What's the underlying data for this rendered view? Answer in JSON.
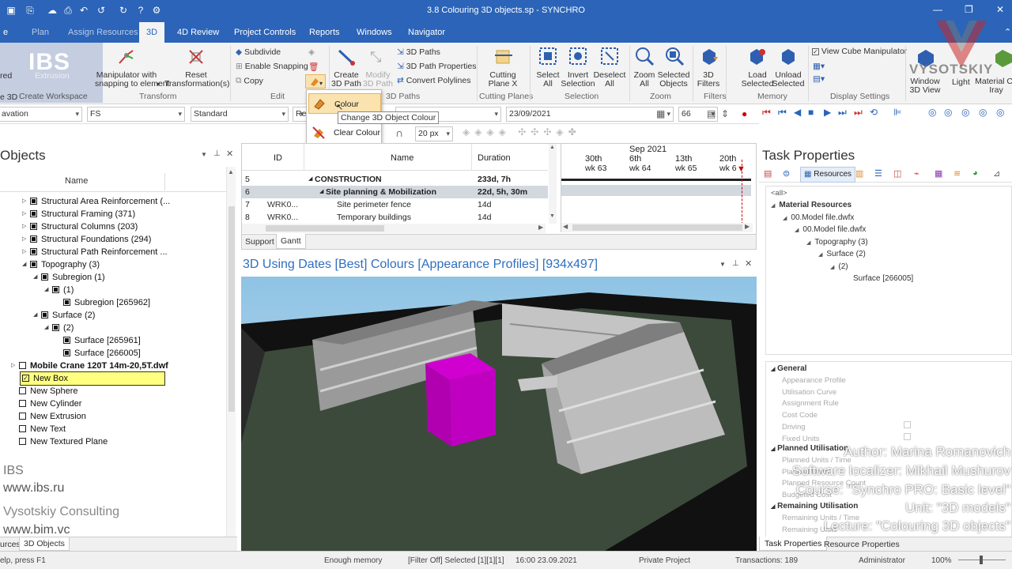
{
  "window": {
    "title": "3.8 Colouring 3D objects.sp - SYNCHRO"
  },
  "ribbon_tabs": [
    "Plan",
    "Assign Resources",
    "3D",
    "4D Review",
    "Project Controls",
    "Reports",
    "Windows",
    "Navigator"
  ],
  "ribbon": {
    "logo_text": "IBS",
    "left_partial": [
      "red",
      "e 3D"
    ],
    "create_workspace": "Create Workspace",
    "extrusion": "Extrusion",
    "manipulator": [
      "Manipulator with",
      "snapping to element"
    ],
    "reset": [
      "Reset",
      "Transformation(s)"
    ],
    "transform_group": "Transform",
    "subdivide": "Subdivide",
    "enable_snapping": "Enable Snapping",
    "copy": "Copy",
    "edit_group": "Edit",
    "create_path": [
      "Create",
      "3D Path"
    ],
    "modify_path": [
      "Modify",
      "3D Path"
    ],
    "paths": "3D Paths",
    "path_props": "3D Path Properties",
    "convert_poly": "Convert Polylines",
    "paths_group": "3D Paths",
    "cutting_plane": [
      "Cutting",
      "Plane X"
    ],
    "cutting_group": "Cutting Planes",
    "select_all": [
      "Select",
      "All"
    ],
    "invert_sel": [
      "Invert",
      "Selection"
    ],
    "deselect_all": [
      "Deselect",
      "All"
    ],
    "selection_group": "Selection",
    "zoom_all": [
      "Zoom",
      "All"
    ],
    "sel_objects": [
      "Selected",
      "Objects"
    ],
    "zoom_group": "Zoom",
    "filters_btn": [
      "3D",
      "Filters"
    ],
    "filters_group": "Filters",
    "load_sel": [
      "Load",
      "Selected"
    ],
    "unload_sel": [
      "Unload",
      "Selected"
    ],
    "memory_group": "Memory",
    "view_cube": "View Cube Manipulator",
    "display_group": "Display Settings",
    "window_lbl": [
      "Window",
      "3D View"
    ],
    "light": "Light",
    "material": [
      "Material Co",
      "Iray"
    ]
  },
  "dropdown": {
    "colour": "Colour",
    "clear": "Clear Colour",
    "tooltip": "Change 3D Object Colour"
  },
  "toolbar": {
    "elevation": "avation",
    "fs": "FS",
    "standard": "Standard",
    "res": "Res",
    "date": "23/09/2021",
    "num": "66",
    "px": "20 px"
  },
  "objects": {
    "title": "Objects",
    "name_col": "Name",
    "rows": [
      {
        "text": "Structural Area Reinforcement (...",
        "indent": 0,
        "exp": "▷",
        "cb": "f",
        "bold": false
      },
      {
        "text": "Structural Framing (371)",
        "indent": 0,
        "exp": "▷",
        "cb": "f",
        "bold": false
      },
      {
        "text": "Structural Columns (203)",
        "indent": 0,
        "exp": "▷",
        "cb": "f",
        "bold": false
      },
      {
        "text": "Structural Foundations (294)",
        "indent": 0,
        "exp": "▷",
        "cb": "f",
        "bold": false
      },
      {
        "text": "Structural Path Reinforcement ...",
        "indent": 0,
        "exp": "▷",
        "cb": "f",
        "bold": false
      },
      {
        "text": "Topography (3)",
        "indent": 0,
        "exp": "◢",
        "cb": "f",
        "bold": false
      },
      {
        "text": "Subregion (1)",
        "indent": 1,
        "exp": "◢",
        "cb": "f",
        "bold": false
      },
      {
        "text": "(1)",
        "indent": 2,
        "exp": "◢",
        "cb": "f",
        "bold": false
      },
      {
        "text": "Subregion [265962]",
        "indent": 3,
        "exp": "",
        "cb": "f",
        "bold": false
      },
      {
        "text": "Surface (2)",
        "indent": 1,
        "exp": "◢",
        "cb": "f",
        "bold": false
      },
      {
        "text": "(2)",
        "indent": 2,
        "exp": "◢",
        "cb": "f",
        "bold": false
      },
      {
        "text": "Surface [265961]",
        "indent": 3,
        "exp": "",
        "cb": "f",
        "bold": false
      },
      {
        "text": "Surface [266005]",
        "indent": 3,
        "exp": "",
        "cb": "f",
        "bold": false
      },
      {
        "text": "Mobile Crane 120T 14m-20,5T.dwf",
        "indent": -1,
        "exp": "▷",
        "cb": "e",
        "bold": true
      },
      {
        "text": "New Box",
        "indent": -1,
        "exp": "",
        "cb": "c",
        "bold": false
      },
      {
        "text": "New Sphere",
        "indent": -1,
        "exp": "",
        "cb": "e",
        "bold": false
      },
      {
        "text": "New Cylinder",
        "indent": -1,
        "exp": "",
        "cb": "e",
        "bold": false
      },
      {
        "text": "New Extrusion",
        "indent": -1,
        "exp": "",
        "cb": "e",
        "bold": false
      },
      {
        "text": "New Text",
        "indent": -1,
        "exp": "",
        "cb": "e",
        "bold": false
      },
      {
        "text": "New Textured Plane",
        "indent": -1,
        "exp": "",
        "cb": "e",
        "bold": false
      }
    ],
    "tabs": [
      "urces",
      "3D Objects"
    ]
  },
  "gantt": {
    "cols": [
      "ID",
      "Name",
      "Duration"
    ],
    "rows": [
      {
        "n": "5",
        "id": "",
        "name": "CONSTRUCTION",
        "dur": "233d, 7h",
        "bold": true,
        "lvl": 0,
        "exp": "◢"
      },
      {
        "n": "6",
        "id": "",
        "name": "Site planning & Mobilization",
        "dur": "22d, 5h, 30m",
        "bold": true,
        "lvl": 1,
        "exp": "◢"
      },
      {
        "n": "7",
        "id": "WRK0...",
        "name": "Site perimeter fence",
        "dur": "14d",
        "bold": false,
        "lvl": 2,
        "exp": ""
      },
      {
        "n": "8",
        "id": "WRK0...",
        "name": "Temporary buildings",
        "dur": "14d",
        "bold": false,
        "lvl": 2,
        "exp": ""
      }
    ],
    "month": "Sep 2021",
    "days": [
      "30th",
      "6th",
      "13th",
      "20th"
    ],
    "weeks": [
      "wk 63",
      "wk 64",
      "wk 65",
      "wk 6"
    ],
    "tabs": [
      "Support",
      "Gantt"
    ]
  },
  "viewport": {
    "title": "3D Using Dates [Best] Colours [Appearance Profiles]  [934x497]"
  },
  "taskprops": {
    "title": "Task Properties",
    "resources_tab": "Resources",
    "filter": "<all>",
    "tree": [
      {
        "t": "Material Resources",
        "lvl": 0,
        "bold": true,
        "exp": "◢"
      },
      {
        "t": "00.Model file.dwfx",
        "lvl": 1,
        "bold": false,
        "exp": "◢"
      },
      {
        "t": "00.Model file.dwfx",
        "lvl": 2,
        "bold": false,
        "exp": "◢"
      },
      {
        "t": "Topography (3)",
        "lvl": 3,
        "bold": false,
        "exp": "◢"
      },
      {
        "t": "Surface (2)",
        "lvl": 4,
        "bold": false,
        "exp": "◢"
      },
      {
        "t": "(2)",
        "lvl": 5,
        "bold": false,
        "exp": "◢"
      },
      {
        "t": "Surface [266005]",
        "lvl": 6,
        "bold": false,
        "exp": ""
      }
    ],
    "general": "General",
    "general_rows": [
      "Appearance Profile",
      "Utilisation Curve",
      "Assignment Rule",
      "Cost Code",
      "Driving",
      "Fixed Units"
    ],
    "planned": "Planned Utilisation",
    "planned_rows": [
      "Planned Units / Time",
      "Planned Units",
      "Planned Resource Count",
      "Budgeted Cost"
    ],
    "remaining": "Remaining Utilisation",
    "remaining_rows": [
      "Remaining Units / Time",
      "Remaining Units"
    ],
    "tabs": [
      "Task Properties",
      "Resource Properties"
    ]
  },
  "status": {
    "help": "elp, press F1",
    "memory": "Enough memory",
    "filter": "[Filter Off]  Selected [1][1][1]",
    "time": "16:00 23.09.2021",
    "project": "Private Project",
    "transactions": "Transactions: 189",
    "user": "Administrator",
    "zoom": "100%"
  },
  "watermark": {
    "ibs": "IBS",
    "ibs_url": "www.ibs.ru",
    "vys": "Vysotskiy Consulting",
    "bim": "www.bim.vc",
    "vlogo": "VYSOTSKIY",
    "credits": [
      "Author: Marina Romanovich",
      "Software localizer: Mikhail Mushurov",
      "Course: \"Synchro PRO: Basic level\"",
      "Unit: \"3D models\"",
      "Lecture: \"Colouring 3D objects\""
    ]
  },
  "colors": {
    "accent": "#2b64b8",
    "selected": "#ffff80",
    "box": "#b400b4",
    "ground": "#3c4a3c",
    "title": "#2f6fc0"
  }
}
